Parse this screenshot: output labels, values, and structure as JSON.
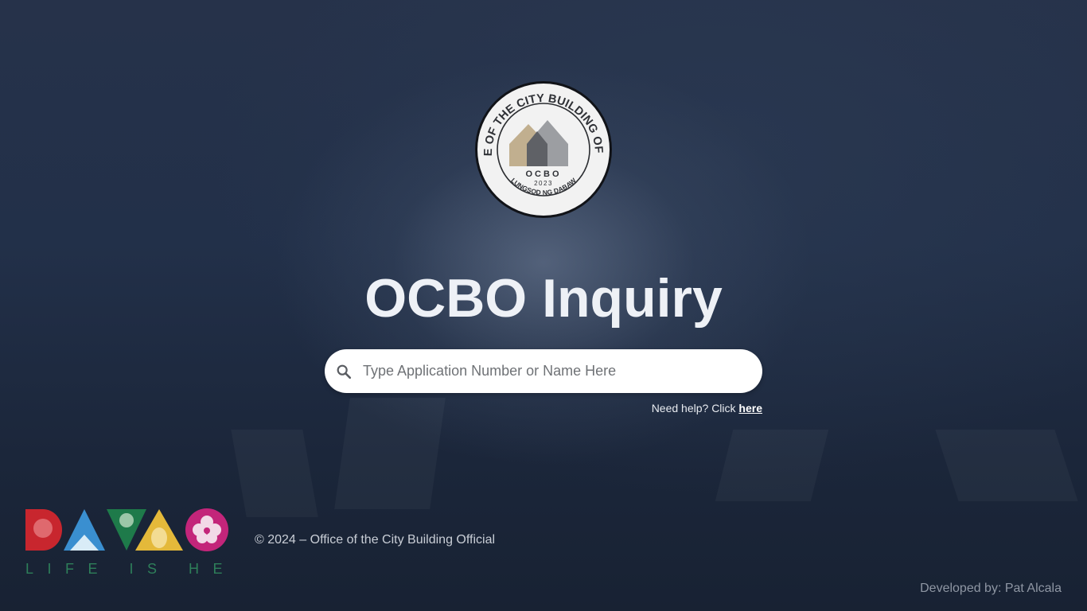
{
  "seal": {
    "outer_text": "OFFICE OF THE CITY BUILDING OFFICIAL",
    "bottom_text": "LUNGSOD NG DABAW",
    "abbrev": "OCBO",
    "year": "2023"
  },
  "header": {
    "title": "OCBO Inquiry"
  },
  "search": {
    "placeholder": "Type Application Number or Name Here",
    "value": "",
    "icon": "search-icon"
  },
  "help": {
    "text": "Need help? Click ",
    "link_label": "here"
  },
  "footer": {
    "logo_tagline": "LIFE IS HERE",
    "copyright": "© 2024 – Office of the City Building Official",
    "developer": "Developed by: Pat Alcala"
  },
  "colors": {
    "title": "#eef1f6",
    "background": "#223049",
    "seal_gold": "#b8a37e",
    "seal_gray": "#5f6166",
    "davao_red": "#c8262e",
    "davao_blue": "#3a8fd0",
    "davao_green": "#1e7a4a",
    "davao_yellow": "#e4b93a",
    "davao_magenta": "#c3257a",
    "tagline_green": "#2e7f5a"
  }
}
